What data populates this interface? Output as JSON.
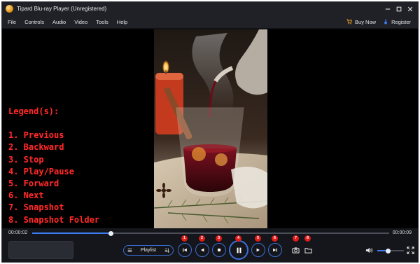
{
  "window": {
    "title": "Tipard Blu-ray Player (Unregistered)"
  },
  "menu": {
    "items": [
      "File",
      "Controls",
      "Audio",
      "Video",
      "Tools",
      "Help"
    ],
    "buy_now": "Buy Now",
    "register": "Register"
  },
  "legend": {
    "title": "Legend(s):",
    "items": [
      "1. Previous",
      "2. Backward",
      "3. Stop",
      "4. Play/Pause",
      "5. Forward",
      "6. Next",
      "7. Snapshot",
      "8. Snapshot Folder"
    ]
  },
  "playback": {
    "current_time": "00:00:02",
    "total_time": "00:00:09",
    "progress_fraction": 0.22,
    "volume_fraction": 0.42
  },
  "controls": {
    "playlist_label": "Playlist",
    "badges": [
      "1",
      "2",
      "3",
      "4",
      "5",
      "6",
      "7",
      "8"
    ]
  },
  "colors": {
    "accent": "#3a6fd8",
    "legend_text": "#ff2a2a",
    "badge": "#e21b1b",
    "background": "#0b0c10"
  }
}
